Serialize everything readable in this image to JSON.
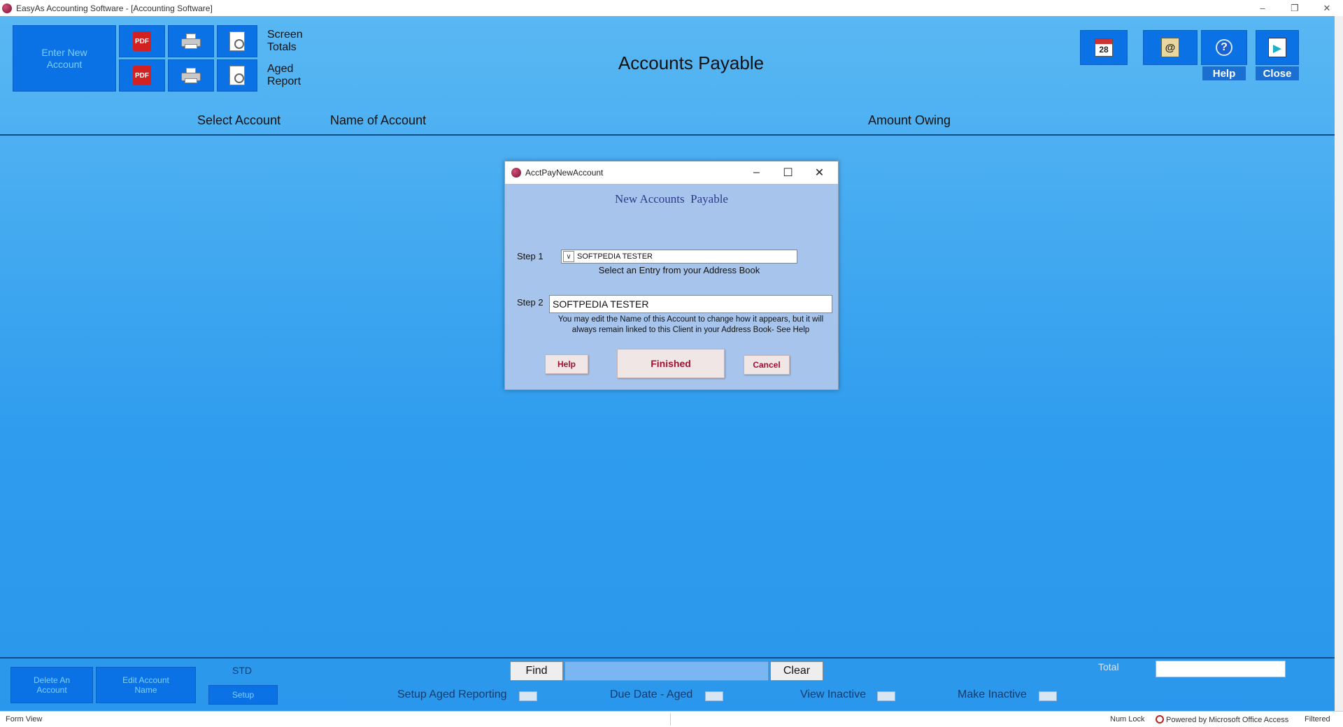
{
  "window": {
    "title": "EasyAs Accounting Software - [Accounting Software]",
    "minimize": "–",
    "restore": "❐",
    "close": "✕"
  },
  "toolbar": {
    "enter_new_account": "Enter New Account",
    "pdf_label": "PDF",
    "screen_totals": "Screen\nTotals",
    "aged_report": "Aged\nReport",
    "calendar_day": "28",
    "address_symbol": "@",
    "help_symbol": "?",
    "help_label": "Help",
    "close_label": "Close"
  },
  "page": {
    "title": "Accounts Payable",
    "columns": [
      "Select Account",
      "Name of Account",
      "Amount Owing"
    ]
  },
  "dialog": {
    "window_title": "AcctPayNewAccount",
    "minimize": "–",
    "maximize": "☐",
    "close": "✕",
    "heading": "New Accounts  Payable",
    "step1_label": "Step 1",
    "step1_value": "SOFTPEDIA TESTER",
    "step1_help": "Select an Entry from your Address Book",
    "step2_label": "Step 2",
    "step2_value": "SOFTPEDIA TESTER",
    "step2_help": "You may edit the Name of this Account to change how it appears, but it will always remain linked to this Client in your Address Book- See Help",
    "help_button": "Help",
    "finished_button": "Finished",
    "cancel_button": "Cancel"
  },
  "footer": {
    "delete_account": "Delete An Account",
    "edit_account_name": "Edit Account Name",
    "std": "STD",
    "setup": "Setup",
    "find": "Find",
    "find_value": "",
    "clear": "Clear",
    "total_label": "Total",
    "total_value": "",
    "options": [
      {
        "label": "Setup Aged Reporting",
        "checked": false
      },
      {
        "label": "Due Date - Aged",
        "checked": false
      },
      {
        "label": "View Inactive",
        "checked": false
      },
      {
        "label": "Make Inactive",
        "checked": false
      }
    ]
  },
  "statusbar": {
    "view": "Form View",
    "num_lock": "Num Lock",
    "powered_by": "Powered by Microsoft Office Access",
    "filtered": "Filtered"
  },
  "colors": {
    "background_top": "#59b8f3",
    "background_bottom": "#2b97ec",
    "button_blue": "#0b72e6",
    "dialog_bg": "#a7c5ec",
    "dialog_button_text": "#a01030"
  }
}
